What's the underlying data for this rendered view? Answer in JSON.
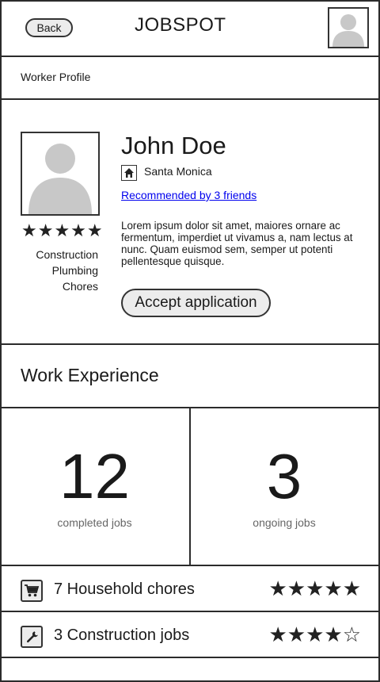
{
  "header": {
    "back_label": "Back",
    "app_title": "JOBSPOT"
  },
  "breadcrumb": "Worker Profile",
  "profile": {
    "name": "John Doe",
    "location": "Santa Monica",
    "recommended": "Recommended by 3 friends",
    "rating_stars": "★★★★★",
    "skills": [
      "Construction",
      "Plumbing",
      "Chores"
    ],
    "bio": "Lorem ipsum dolor sit amet, maiores ornare ac fermentum, imperdiet ut vivamus a, nam lectus at nunc. Quam euismod sem, semper ut potenti pellentesque quisque.",
    "accept_label": "Accept application"
  },
  "work_experience": {
    "title": "Work Experience",
    "stats": [
      {
        "value": "12",
        "label": "completed jobs"
      },
      {
        "value": "3",
        "label": "ongoing jobs"
      }
    ],
    "categories": [
      {
        "label": "7 Household chores",
        "icon": "cart-icon",
        "stars": "★★★★★"
      },
      {
        "label": "3 Construction jobs",
        "icon": "wrench-icon",
        "stars": "★★★★☆"
      }
    ]
  }
}
